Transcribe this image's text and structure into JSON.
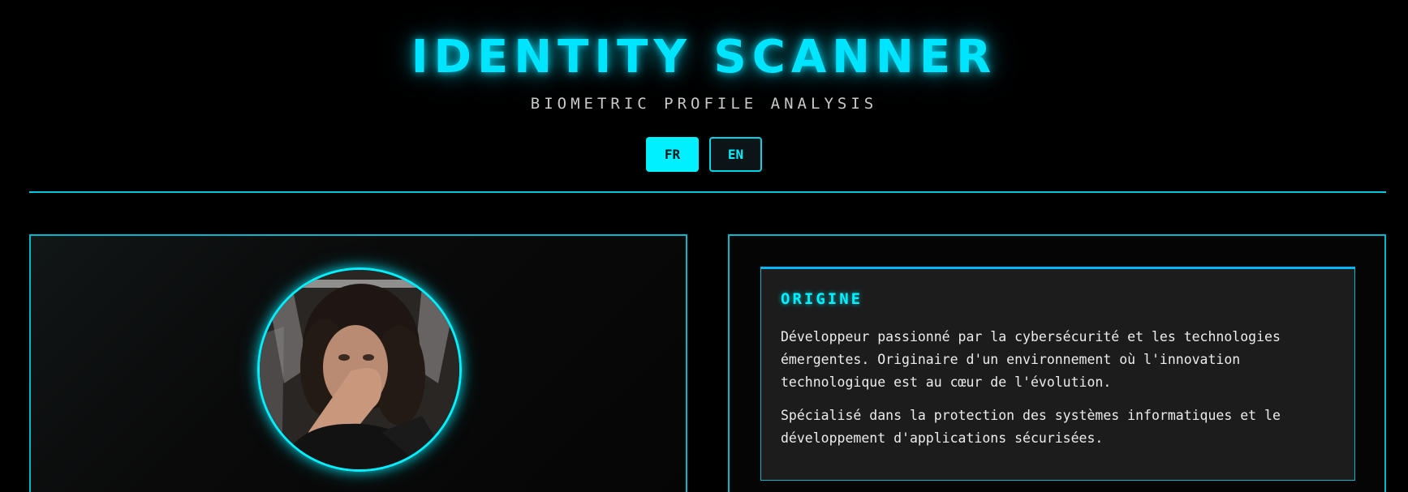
{
  "header": {
    "title": "IDENTITY SCANNER",
    "subtitle": "BIOMETRIC PROFILE ANALYSIS"
  },
  "language": {
    "options": [
      {
        "label": "FR",
        "active": true
      },
      {
        "label": "EN",
        "active": false
      }
    ]
  },
  "profile": {
    "avatar_icon": "profile-photo"
  },
  "info": {
    "section_title": "ORIGINE",
    "paragraphs": [
      "Développeur passionné par la cybersécurité et les technologies émergentes. Originaire d'un environnement où l'innovation technologique est au cœur de l'évolution.",
      "Spécialisé dans la protection des systèmes informatiques et le développement d'applications sécurisées."
    ]
  },
  "colors": {
    "accent": "#00f0ff",
    "background": "#000000",
    "card": "#1c1c1c"
  }
}
